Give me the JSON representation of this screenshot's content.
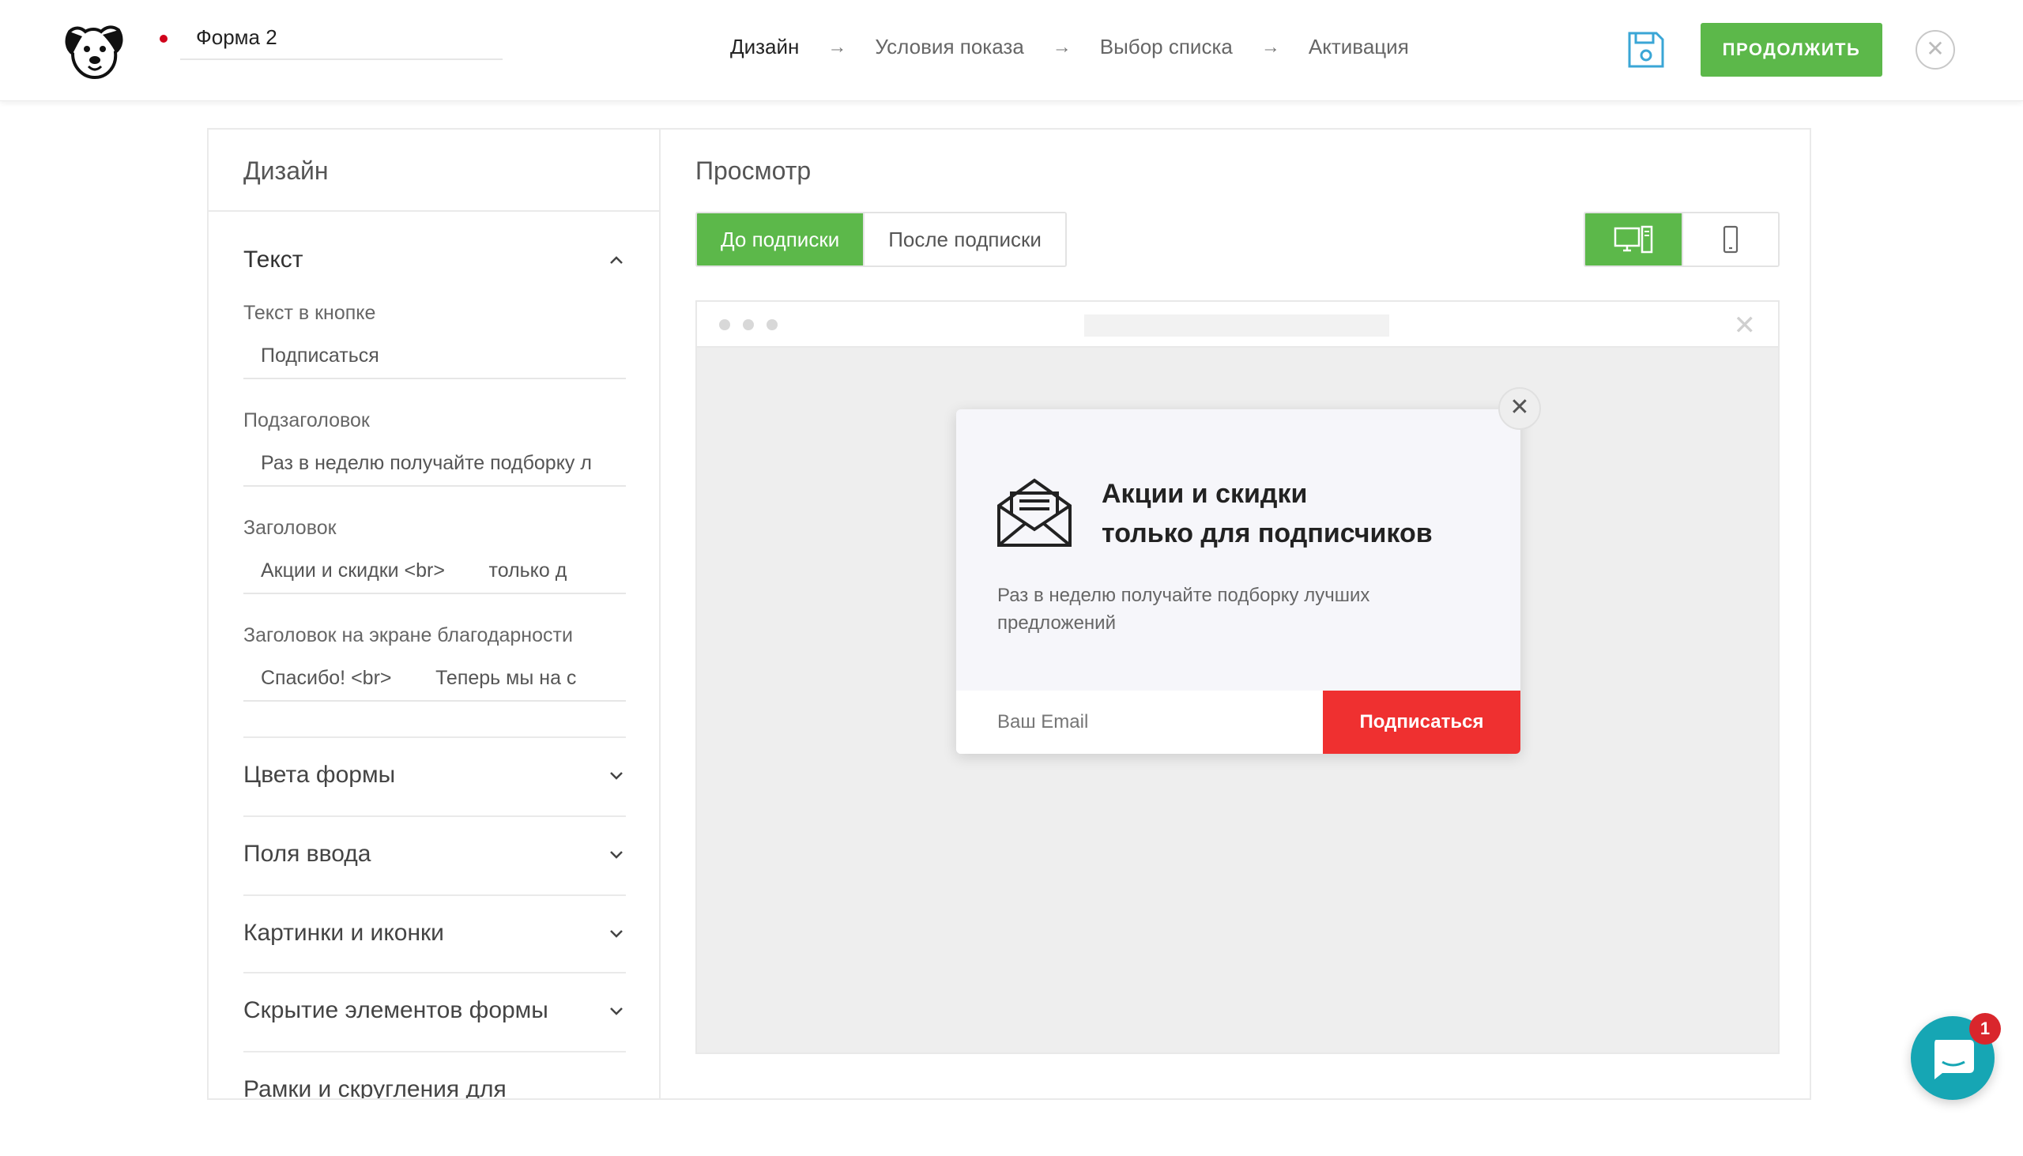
{
  "header": {
    "form_name": "Форма 2",
    "steps": [
      "Дизайн",
      "Условия показа",
      "Выбор списка",
      "Активация"
    ],
    "arrow": "→",
    "continue_label": "ПРОДОЛЖИТЬ",
    "close_glyph": "✕",
    "icons": {
      "logo": "dog-logo-icon",
      "save": "floppy-save-icon",
      "close": "close-icon"
    }
  },
  "sidebar": {
    "title": "Дизайн",
    "open_section": "Текст",
    "fields": [
      {
        "label": "Текст в кнопке",
        "value": "Подписаться"
      },
      {
        "label": "Подзаголовок",
        "value": "Раз в неделю получайте подборку л"
      },
      {
        "label": "Заголовок",
        "value": "Акции и скидки <br>        только д"
      },
      {
        "label": "Заголовок на экране благодарности",
        "value": "Спасибо! <br>        Теперь мы на с"
      }
    ],
    "sections": [
      "Цвета формы",
      "Поля ввода",
      "Картинки и иконки",
      "Скрытие элементов формы",
      "Рамки и скругления для"
    ]
  },
  "preview": {
    "title": "Просмотр",
    "tabs": [
      "До подписки",
      "После подписки"
    ],
    "active_tab": 0,
    "devices": [
      "desktop-icon",
      "mobile-icon"
    ],
    "active_device": 0,
    "popup": {
      "title_line1": "Акции и скидки",
      "title_line2": "только для подписчиков",
      "subtitle": "Раз в неделю получайте подборку лучших предложений",
      "email_placeholder": "Ваш Email",
      "button_label": "Подписаться",
      "close_glyph": "✕"
    }
  },
  "chat": {
    "badge": "1"
  },
  "colors": {
    "accent_green": "#5cb84a",
    "popup_button": "#ef3030",
    "chat": "#16a6b4",
    "badge": "#d9262c"
  }
}
